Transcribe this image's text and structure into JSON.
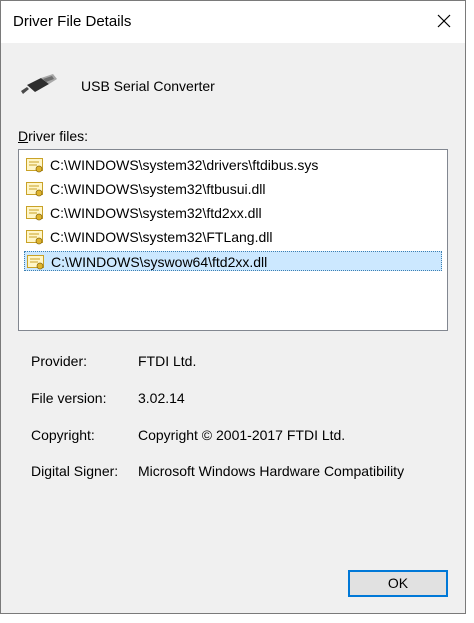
{
  "window": {
    "title": "Driver File Details"
  },
  "device": {
    "name": "USB Serial Converter",
    "icon": "usb-cable-icon"
  },
  "driver_files": {
    "label_mnemonic": "D",
    "label_rest": "river files:",
    "items": [
      {
        "path": "C:\\WINDOWS\\system32\\drivers\\ftdibus.sys",
        "selected": false
      },
      {
        "path": "C:\\WINDOWS\\system32\\ftbusui.dll",
        "selected": false
      },
      {
        "path": "C:\\WINDOWS\\system32\\ftd2xx.dll",
        "selected": false
      },
      {
        "path": "C:\\WINDOWS\\system32\\FTLang.dll",
        "selected": false
      },
      {
        "path": "C:\\WINDOWS\\syswow64\\ftd2xx.dll",
        "selected": true
      }
    ]
  },
  "details": {
    "provider_label": "Provider:",
    "provider_value": "FTDI Ltd.",
    "version_label": "File version:",
    "version_value": "3.02.14",
    "copyright_label": "Copyright:",
    "copyright_value": "Copyright © 2001-2017 FTDI Ltd.",
    "signer_label": "Digital Signer:",
    "signer_value": "Microsoft Windows Hardware Compatibility"
  },
  "buttons": {
    "ok_label": "OK"
  },
  "colors": {
    "selection": "#cce8ff",
    "focus_border": "#0078d7"
  }
}
